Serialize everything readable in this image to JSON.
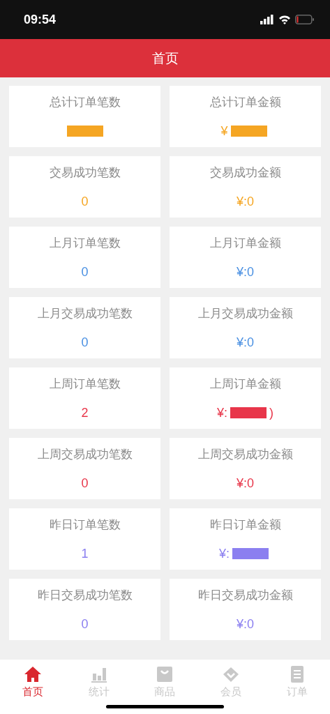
{
  "status_bar": {
    "time": "09:54"
  },
  "header": {
    "title": "首页"
  },
  "cards": [
    {
      "label": "总计订单笔数",
      "masked": true,
      "color": "#f5a623"
    },
    {
      "label": "总计订单金额",
      "value": "¥",
      "masked": true,
      "color": "#f5a623"
    },
    {
      "label": "交易成功笔数",
      "value": "0",
      "masked": false,
      "color": "#f5a623"
    },
    {
      "label": "交易成功金额",
      "value": "¥:0",
      "masked": false,
      "color": "#f5a623"
    },
    {
      "label": "上月订单笔数",
      "value": "0",
      "masked": false,
      "color": "#4a90e2"
    },
    {
      "label": "上月订单金额",
      "value": "¥:0",
      "masked": false,
      "color": "#4a90e2"
    },
    {
      "label": "上月交易成功笔数",
      "value": "0",
      "masked": false,
      "color": "#4a90e2"
    },
    {
      "label": "上月交易成功金额",
      "value": "¥:0",
      "masked": false,
      "color": "#4a90e2"
    },
    {
      "label": "上周订单笔数",
      "value": "2",
      "masked": false,
      "color": "#e8364a"
    },
    {
      "label": "上周订单金额",
      "value": "¥:",
      "masked": true,
      "value_end": ")",
      "color": "#e8364a"
    },
    {
      "label": "上周交易成功笔数",
      "value": "0",
      "masked": false,
      "color": "#e8364a"
    },
    {
      "label": "上周交易成功金额",
      "value": "¥:0",
      "masked": false,
      "color": "#e8364a"
    },
    {
      "label": "昨日订单笔数",
      "value": "1",
      "masked": false,
      "color": "#8b7ff0"
    },
    {
      "label": "昨日订单金额",
      "value": "¥:",
      "masked": true,
      "color": "#8b7ff0"
    },
    {
      "label": "昨日交易成功笔数",
      "value": "0",
      "masked": false,
      "color": "#8b7ff0"
    },
    {
      "label": "昨日交易成功金额",
      "value": "¥:0",
      "masked": false,
      "color": "#8b7ff0"
    }
  ],
  "tab_bar": [
    {
      "label": "首页",
      "kind": "home",
      "selected": true
    },
    {
      "label": "统计",
      "kind": "stats",
      "selected": false
    },
    {
      "label": "商品",
      "kind": "goods",
      "selected": false
    },
    {
      "label": "会员",
      "kind": "member",
      "selected": false
    },
    {
      "label": "订单",
      "kind": "orders",
      "selected": false
    }
  ]
}
